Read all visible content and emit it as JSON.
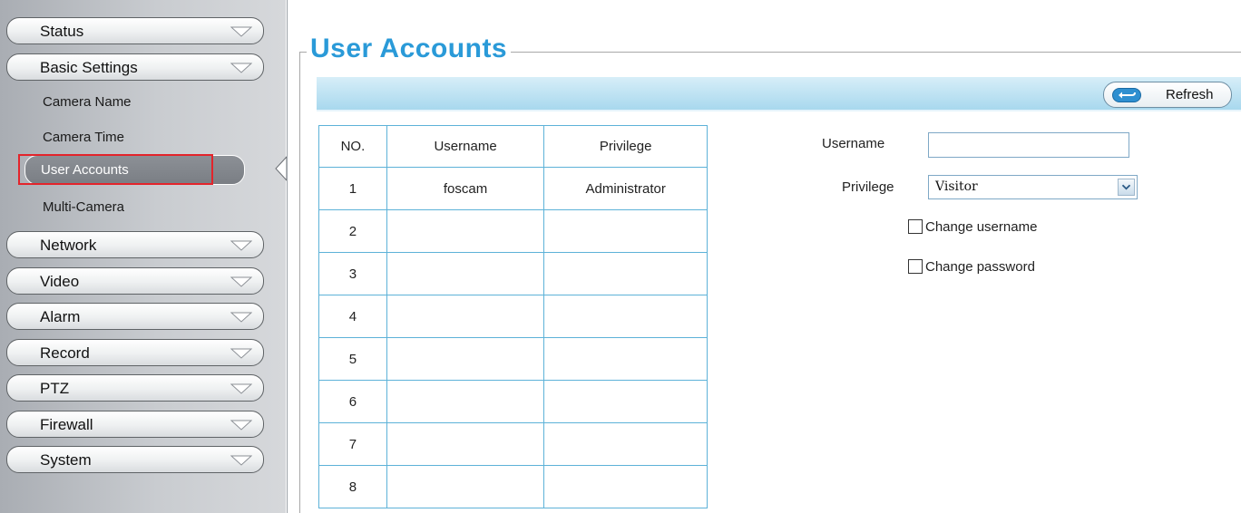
{
  "sidebar": {
    "menus": [
      {
        "label": "Status"
      },
      {
        "label": "Basic Settings"
      },
      {
        "label": "Network"
      },
      {
        "label": "Video"
      },
      {
        "label": "Alarm"
      },
      {
        "label": "Record"
      },
      {
        "label": "PTZ"
      },
      {
        "label": "Firewall"
      },
      {
        "label": "System"
      }
    ],
    "submenu": {
      "camera_name": "Camera Name",
      "camera_time": "Camera Time",
      "user_accounts": "User Accounts",
      "multi_camera": "Multi-Camera"
    },
    "highlight_color": "#e3242b"
  },
  "main": {
    "title": "User Accounts",
    "refresh_label": "Refresh",
    "table": {
      "headers": [
        "NO.",
        "Username",
        "Privilege"
      ],
      "rows": [
        {
          "no": "1",
          "username": "foscam",
          "privilege": "Administrator"
        },
        {
          "no": "2",
          "username": "",
          "privilege": ""
        },
        {
          "no": "3",
          "username": "",
          "privilege": ""
        },
        {
          "no": "4",
          "username": "",
          "privilege": ""
        },
        {
          "no": "5",
          "username": "",
          "privilege": ""
        },
        {
          "no": "6",
          "username": "",
          "privilege": ""
        },
        {
          "no": "7",
          "username": "",
          "privilege": ""
        },
        {
          "no": "8",
          "username": "",
          "privilege": ""
        }
      ]
    },
    "form": {
      "username_label": "Username",
      "username_value": "",
      "privilege_label": "Privilege",
      "privilege_value": "Visitor",
      "change_username_label": "Change username",
      "change_username_checked": false,
      "change_password_label": "Change password",
      "change_password_checked": false
    },
    "accent_color": "#2a9ad8"
  }
}
